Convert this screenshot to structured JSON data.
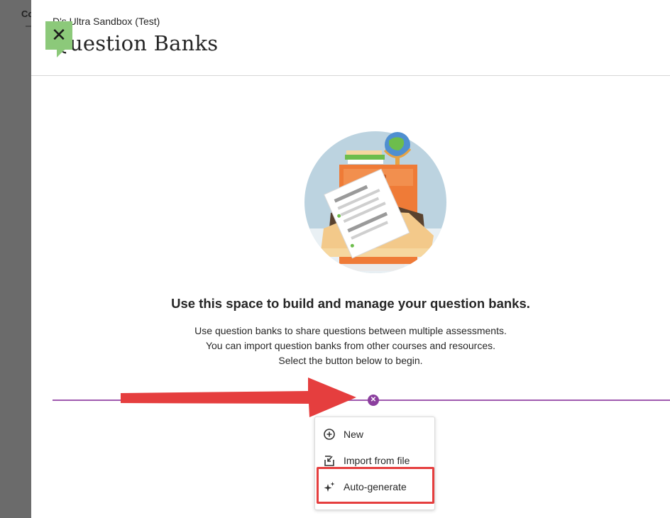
{
  "background": {
    "partial_text": "Co"
  },
  "panel": {
    "close_icon": "close-icon",
    "course_name": "D's Ultra Sandbox (Test)",
    "title": "Question Banks"
  },
  "empty_state": {
    "illustration": "question-bank-cabinet-illustration",
    "heading": "Use this space to build and manage your question banks.",
    "description_lines": [
      "Use question banks to share questions between multiple assessments.",
      "You can import question banks from other courses and resources.",
      "Select the button below to begin."
    ]
  },
  "add_menu": {
    "toggle_icon": "close-icon",
    "items": [
      {
        "label": "New",
        "icon": "plus-circle-icon"
      },
      {
        "label": "Import from file",
        "icon": "import-icon"
      },
      {
        "label": "Auto-generate",
        "icon": "sparkle-icon"
      }
    ]
  },
  "annotations": {
    "arrow_color": "#e53e3e",
    "highlight_color": "#e53e3e",
    "highlighted_item": "Auto-generate"
  },
  "colors": {
    "accent_purple": "#8b3f9e",
    "close_green": "#8cc97a"
  }
}
